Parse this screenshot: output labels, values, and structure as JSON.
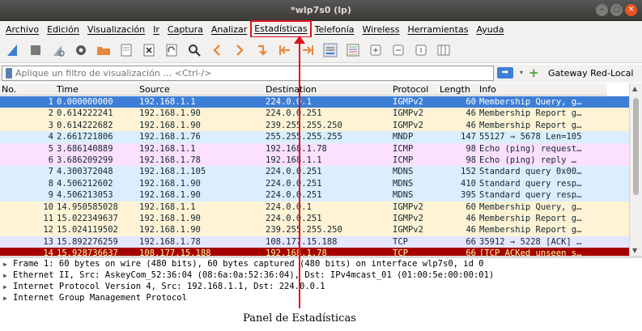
{
  "window": {
    "title": "*wlp7s0 (lp)",
    "buttons": [
      "–",
      "▢",
      "✕"
    ]
  },
  "menu": [
    "Archivo",
    "Edición",
    "Visualización",
    "Ir",
    "Captura",
    "Analizar",
    "Estadísticas",
    "Telefonía",
    "Wireless",
    "Herramientas",
    "Ayuda"
  ],
  "toolbar_icons": [
    "shark-fin-start-icon",
    "stop-icon",
    "restart-shark-icon",
    "options-gear-icon",
    "open-folder-icon",
    "file-icon",
    "close-file-icon",
    "reload-icon",
    "search-icon",
    "go-back-icon",
    "go-forward-icon",
    "go-to-packet-icon",
    "first-packet-icon",
    "last-packet-icon",
    "autoscroll-icon",
    "colorize-icon",
    "zoom-in-icon",
    "zoom-out-icon",
    "normal-size-icon",
    "resize-columns-icon"
  ],
  "filter": {
    "placeholder": "Aplique un filtro de visualización … <Ctrl-/>",
    "profile": "Gateway Red-Local"
  },
  "columns": [
    "No.",
    "Time",
    "Source",
    "Destination",
    "Protocol",
    "Length",
    "Info"
  ],
  "packets": [
    {
      "no": "1",
      "time": "0.000000000",
      "src": "192.168.1.1",
      "dst": "224.0.0.1",
      "proto": "IGMPv2",
      "len": "60",
      "info": "Membership Query, g…",
      "bg": "#3d7ed6",
      "fg": "#ffffff"
    },
    {
      "no": "2",
      "time": "0.614222241",
      "src": "192.168.1.90",
      "dst": "224.0.0.251",
      "proto": "IGMPv2",
      "len": "46",
      "info": "Membership Report g…",
      "bg": "#fff3d6",
      "fg": "#12272e"
    },
    {
      "no": "3",
      "time": "0.614222682",
      "src": "192.168.1.90",
      "dst": "239.255.255.250",
      "proto": "IGMPv2",
      "len": "46",
      "info": "Membership Report g…",
      "bg": "#fff3d6",
      "fg": "#12272e"
    },
    {
      "no": "4",
      "time": "2.661721806",
      "src": "192.168.1.76",
      "dst": "255.255.255.255",
      "proto": "MNDP",
      "len": "147",
      "info": "55127 → 5678 Len=105",
      "bg": "#daeeff",
      "fg": "#12272e"
    },
    {
      "no": "5",
      "time": "3.686140889",
      "src": "192.168.1.1",
      "dst": "192.168.1.78",
      "proto": "ICMP",
      "len": "98",
      "info": "Echo (ping) request…",
      "bg": "#fce0ff",
      "fg": "#12272e"
    },
    {
      "no": "6",
      "time": "3.686209299",
      "src": "192.168.1.78",
      "dst": "192.168.1.1",
      "proto": "ICMP",
      "len": "98",
      "info": "Echo (ping) reply  …",
      "bg": "#fce0ff",
      "fg": "#12272e"
    },
    {
      "no": "7",
      "time": "4.300372048",
      "src": "192.168.1.105",
      "dst": "224.0.0.251",
      "proto": "MDNS",
      "len": "152",
      "info": "Standard query 0x00…",
      "bg": "#daeeff",
      "fg": "#12272e"
    },
    {
      "no": "8",
      "time": "4.506212602",
      "src": "192.168.1.90",
      "dst": "224.0.0.251",
      "proto": "MDNS",
      "len": "410",
      "info": "Standard query resp…",
      "bg": "#daeeff",
      "fg": "#12272e"
    },
    {
      "no": "9",
      "time": "4.506213053",
      "src": "192.168.1.90",
      "dst": "224.0.0.251",
      "proto": "MDNS",
      "len": "395",
      "info": "Standard query resp…",
      "bg": "#daeeff",
      "fg": "#12272e"
    },
    {
      "no": "10",
      "time": "14.950585028",
      "src": "192.168.1.1",
      "dst": "224.0.0.1",
      "proto": "IGMPv2",
      "len": "60",
      "info": "Membership Query, g…",
      "bg": "#fff3d6",
      "fg": "#12272e"
    },
    {
      "no": "11",
      "time": "15.022349637",
      "src": "192.168.1.90",
      "dst": "224.0.0.251",
      "proto": "IGMPv2",
      "len": "46",
      "info": "Membership Report g…",
      "bg": "#fff3d6",
      "fg": "#12272e"
    },
    {
      "no": "12",
      "time": "15.024119502",
      "src": "192.168.1.90",
      "dst": "239.255.255.250",
      "proto": "IGMPv2",
      "len": "46",
      "info": "Membership Report g…",
      "bg": "#fff3d6",
      "fg": "#12272e"
    },
    {
      "no": "13",
      "time": "15.892276259",
      "src": "192.168.1.78",
      "dst": "108.177.15.188",
      "proto": "TCP",
      "len": "66",
      "info": "35912 → 5228 [ACK] …",
      "bg": "#e7e6ff",
      "fg": "#12272e"
    },
    {
      "no": "14",
      "time": "15.928736637",
      "src": "108.177.15.188",
      "dst": "192.168.1.78",
      "proto": "TCP",
      "len": "66",
      "info": "[TCP ACKed unseen s…",
      "bg": "#a40000",
      "fg": "#fffc9c"
    }
  ],
  "details": [
    "Frame 1: 60 bytes on wire (480 bits), 60 bytes captured (480 bits) on interface wlp7s0, id 0",
    "Ethernet II, Src: AskeyCom_52:36:04 (08:6a:0a:52:36:04), Dst: IPv4mcast_01 (01:00:5e:00:00:01)",
    "Internet Protocol Version 4, Src: 192.168.1.1, Dst: 224.0.0.1",
    "Internet Group Management Protocol"
  ],
  "caption": "Panel de Estadísticas",
  "colors": {
    "highlight": "#e0101c",
    "selected": "#3d7ed6"
  }
}
